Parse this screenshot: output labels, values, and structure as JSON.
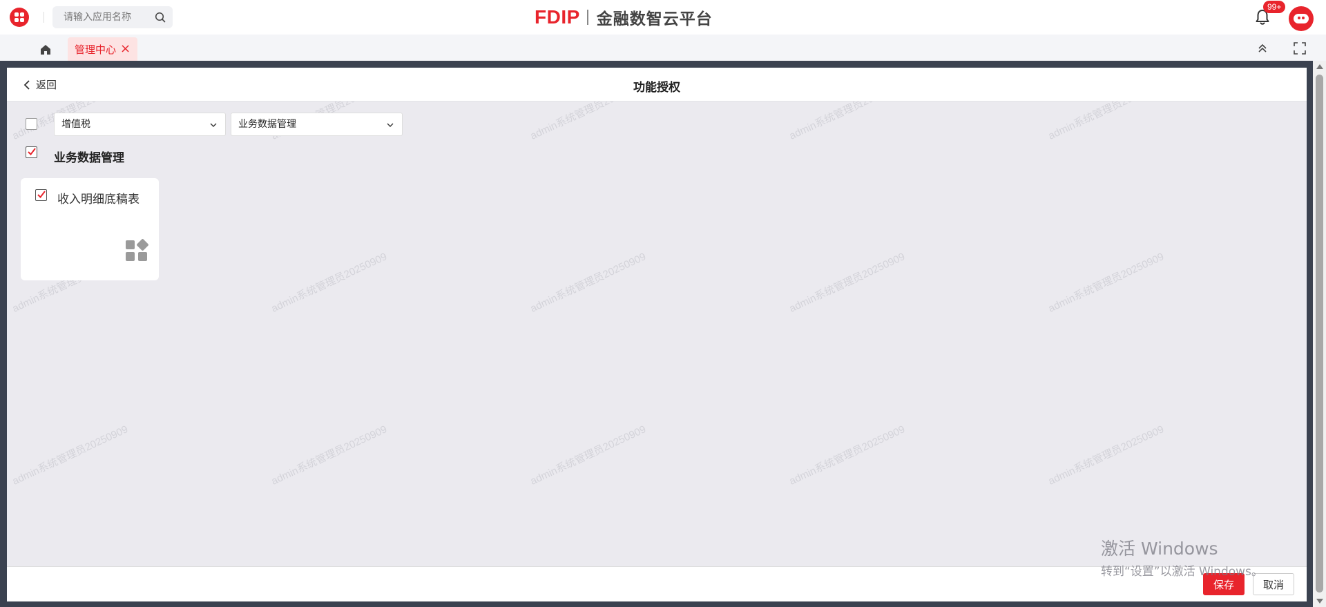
{
  "header": {
    "search_placeholder": "请输入应用名称",
    "brand_mark": "FDIP",
    "brand_name": "金融数智云平台",
    "notification_count": "99+",
    "accent_color": "#e8242c"
  },
  "tabs": [
    {
      "label": "管理中心",
      "active": true
    }
  ],
  "panel": {
    "back_label": "返回",
    "title": "功能授权",
    "filter_tax_type": "增值税",
    "filter_category": "业务数据管理",
    "section_title": "业务数据管理",
    "section_checked": true,
    "select_all_checked": false,
    "cards": [
      {
        "label": "收入明细底稿表",
        "checked": true,
        "icon": "app-grid-icon"
      }
    ]
  },
  "watermark_text": "admin系统管理员20250909",
  "footer": {
    "save_label": "保存",
    "cancel_label": "取消"
  },
  "os_overlay": {
    "title": "激活 Windows",
    "subtitle": "转到“设置”以激活 Windows。"
  }
}
